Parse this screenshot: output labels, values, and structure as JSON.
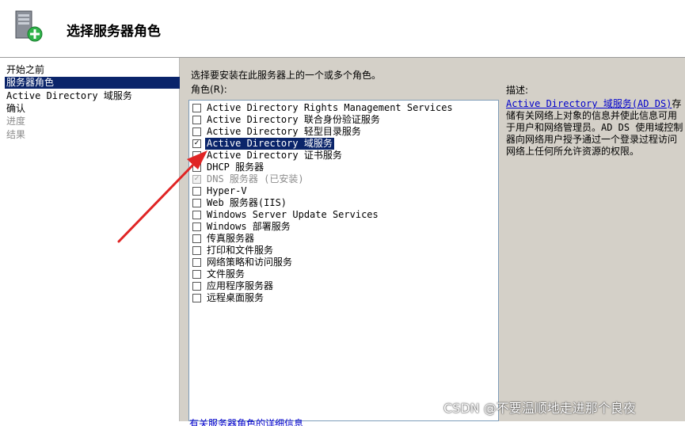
{
  "header": {
    "title": "选择服务器角色",
    "icon": "server-add-icon"
  },
  "nav": {
    "items": [
      {
        "label": "开始之前",
        "state": "normal"
      },
      {
        "label": "服务器角色",
        "state": "active"
      },
      {
        "label": "Active Directory 域服务",
        "state": "normal"
      },
      {
        "label": "确认",
        "state": "normal"
      },
      {
        "label": "进度",
        "state": "disabled"
      },
      {
        "label": "结果",
        "state": "disabled"
      }
    ]
  },
  "main": {
    "instruction": "选择要安装在此服务器上的一个或多个角色。",
    "roles_label": "角色(R):",
    "roles": [
      {
        "label": "Active Directory Rights Management Services",
        "checked": false
      },
      {
        "label": "Active Directory 联合身份验证服务",
        "checked": false
      },
      {
        "label": "Active Directory 轻型目录服务",
        "checked": false
      },
      {
        "label": "Active Directory 域服务",
        "checked": true,
        "selected": true
      },
      {
        "label": "Active Directory 证书服务",
        "checked": false
      },
      {
        "label": "DHCP 服务器",
        "checked": false
      },
      {
        "label": "DNS 服务器  (已安装)",
        "checked": true,
        "disabled": true
      },
      {
        "label": "Hyper-V",
        "checked": false
      },
      {
        "label": "Web 服务器(IIS)",
        "checked": false
      },
      {
        "label": "Windows Server Update Services",
        "checked": false
      },
      {
        "label": "Windows 部署服务",
        "checked": false
      },
      {
        "label": "传真服务器",
        "checked": false
      },
      {
        "label": "打印和文件服务",
        "checked": false
      },
      {
        "label": "网络策略和访问服务",
        "checked": false
      },
      {
        "label": "文件服务",
        "checked": false
      },
      {
        "label": "应用程序服务器",
        "checked": false
      },
      {
        "label": "远程桌面服务",
        "checked": false
      }
    ],
    "description_label": "描述:",
    "description_link": "Active Directory 域服务(AD DS)",
    "description_text": "存储有关网络上对象的信息并使此信息可用于用户和网络管理员。AD DS 使用域控制器向网络用户授予通过一个登录过程访问网络上任何所允许资源的权限。",
    "more_link": "有关服务器角色的详细信息"
  },
  "watermark": "CSDN @不要温顺地走进那个良夜",
  "colors": {
    "selection": "#0a246a",
    "panel": "#d4d0c8",
    "arrow": "#e02424",
    "link": "#0000cc"
  }
}
